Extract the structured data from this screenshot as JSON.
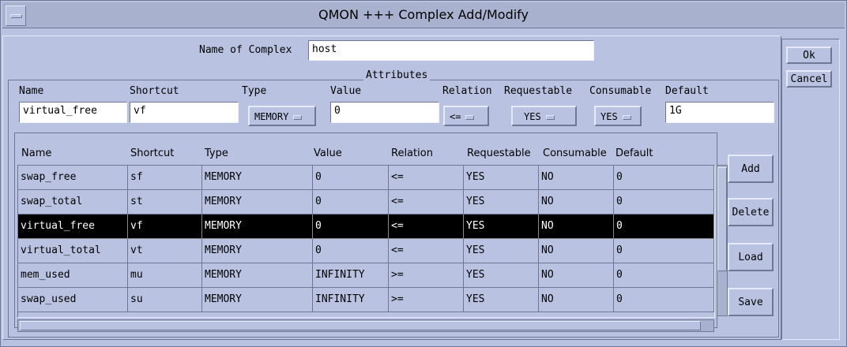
{
  "window": {
    "title": "QMON +++ Complex Add/Modify"
  },
  "complex": {
    "name_label": "Name of Complex",
    "name_value": "host"
  },
  "attributes": {
    "group_label": "Attributes",
    "labels": {
      "name": "Name",
      "shortcut": "Shortcut",
      "type": "Type",
      "value": "Value",
      "relation": "Relation",
      "requestable": "Requestable",
      "consumable": "Consumable",
      "default": "Default"
    },
    "values": {
      "name": "virtual_free",
      "shortcut": "vf",
      "type": "MEMORY",
      "value": "0",
      "relation": "<=",
      "requestable": "YES",
      "consumable": "YES",
      "default": "1G"
    }
  },
  "table": {
    "headers": [
      "Name",
      "Shortcut",
      "Type",
      "Value",
      "Relation",
      "Requestable",
      "Consumable",
      "Default"
    ],
    "rows": [
      [
        "swap_free",
        "sf",
        "MEMORY",
        "0",
        "<=",
        "YES",
        "NO",
        "0"
      ],
      [
        "swap_total",
        "st",
        "MEMORY",
        "0",
        "<=",
        "YES",
        "NO",
        "0"
      ],
      [
        "virtual_free",
        "vf",
        "MEMORY",
        "0",
        "<=",
        "YES",
        "NO",
        "0"
      ],
      [
        "virtual_total",
        "vt",
        "MEMORY",
        "0",
        "<=",
        "YES",
        "NO",
        "0"
      ],
      [
        "mem_used",
        "mu",
        "MEMORY",
        "INFINITY",
        ">=",
        "YES",
        "NO",
        "0"
      ],
      [
        "swap_used",
        "su",
        "MEMORY",
        "INFINITY",
        ">=",
        "YES",
        "NO",
        "0"
      ]
    ],
    "selected_row": "virtual_free"
  },
  "buttons": {
    "add": "Add",
    "delete": "Delete",
    "load": "Load",
    "save": "Save",
    "ok": "Ok",
    "cancel": "Cancel"
  },
  "icons": {
    "window_menu": "window-menu-icon"
  },
  "colors": {
    "background": "#b9c3e1",
    "field": "#ffffff",
    "selection": "#000000"
  }
}
